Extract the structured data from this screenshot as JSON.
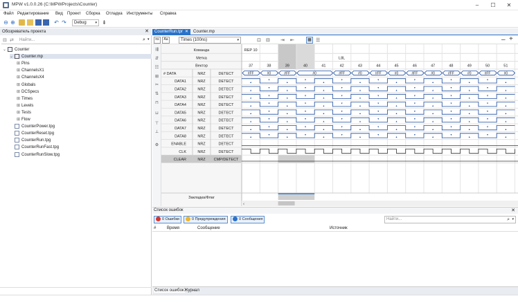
{
  "window": {
    "title": "MPW v1.0.0.26 (C:\\MPWProjects\\Counter)"
  },
  "menu": [
    "Файл",
    "Редактирование",
    "Вид",
    "Проект",
    "Сборка",
    "Отладка",
    "Инструменты",
    "Справка"
  ],
  "toolbar": {
    "config": "Debug"
  },
  "explorer": {
    "title": "Обозреватель проекта",
    "search_placeholder": "Найти...",
    "tree": [
      {
        "label": "Counter",
        "depth": 0,
        "kind": "solution",
        "expand": "v"
      },
      {
        "label": "Counter.mp",
        "depth": 1,
        "kind": "project",
        "expand": "v",
        "selected": true
      },
      {
        "label": "Pins",
        "depth": 2,
        "kind": "group",
        "expand": "+"
      },
      {
        "label": "ChannelsX1",
        "depth": 2,
        "kind": "group",
        "expand": "+"
      },
      {
        "label": "ChannelsX4",
        "depth": 2,
        "kind": "group",
        "expand": "+"
      },
      {
        "label": "Globals",
        "depth": 2,
        "kind": "group",
        "expand": "+"
      },
      {
        "label": "DCSpecs",
        "depth": 2,
        "kind": "group",
        "expand": "+"
      },
      {
        "label": "Times",
        "depth": 2,
        "kind": "group",
        "expand": "+"
      },
      {
        "label": "Levels",
        "depth": 2,
        "kind": "group",
        "expand": "+"
      },
      {
        "label": "Tests",
        "depth": 2,
        "kind": "group",
        "expand": "+"
      },
      {
        "label": "Flow",
        "depth": 2,
        "kind": "group",
        "expand": "+"
      },
      {
        "label": "CounterPower.tpg",
        "depth": 1,
        "kind": "file"
      },
      {
        "label": "CounterReset.tpg",
        "depth": 1,
        "kind": "file"
      },
      {
        "label": "CounterRun.tpg",
        "depth": 1,
        "kind": "file"
      },
      {
        "label": "CounterRunFast.tpg",
        "depth": 1,
        "kind": "file"
      },
      {
        "label": "CounterRunSlow.tpg",
        "depth": 1,
        "kind": "file"
      }
    ]
  },
  "tabs": [
    {
      "label": "CounterRun.tpr",
      "active": true,
      "close": "✕"
    },
    {
      "label": "Counter.mp",
      "active": false
    }
  ],
  "wf_toolbar": {
    "times": "Times (100ns)"
  },
  "grid": {
    "header_rows": [
      {
        "label": "Команда",
        "values": {
          "0": "REP 10"
        }
      },
      {
        "label": "Метка",
        "values": {
          "5": "L8L"
        }
      },
      {
        "label": "Вектор",
        "values": {}
      }
    ],
    "vectors": [
      "37",
      "38",
      "39",
      "40",
      "41",
      "42",
      "43",
      "44",
      "45",
      "46",
      "47",
      "48",
      "49",
      "50",
      "51"
    ],
    "signals": [
      {
        "name": "# DATA",
        "fmt": "NRZ",
        "mode": "DETECT",
        "bus": true
      },
      {
        "name": "DATA1",
        "fmt": "NRZ",
        "mode": "DETECT"
      },
      {
        "name": "DATA2",
        "fmt": "NRZ",
        "mode": "DETECT"
      },
      {
        "name": "DATA3",
        "fmt": "NRZ",
        "mode": "DETECT"
      },
      {
        "name": "DATA4",
        "fmt": "NRZ",
        "mode": "DETECT"
      },
      {
        "name": "DATA5",
        "fmt": "NRZ",
        "mode": "DETECT"
      },
      {
        "name": "DATA6",
        "fmt": "NRZ",
        "mode": "DETECT"
      },
      {
        "name": "DATA7",
        "fmt": "NRZ",
        "mode": "DETECT"
      },
      {
        "name": "DATA8",
        "fmt": "NRZ",
        "mode": "DETECT"
      },
      {
        "name": "ENABLE",
        "fmt": "NRZ",
        "mode": "DETECT"
      },
      {
        "name": "CLK",
        "fmt": "NRZ",
        "mode": "DETECT"
      },
      {
        "name": "CLEAR",
        "fmt": "NRZ",
        "mode": "CMP/DETECT",
        "selected": true
      }
    ],
    "bus_values": [
      "#FF",
      "#0",
      "#FF",
      "#0",
      "",
      "#FF",
      "#0",
      "#FF",
      "#0",
      "#FF",
      "#0",
      "#FF",
      "#0",
      "#FF",
      "#0"
    ],
    "bookmark_label": "Закладка/Флаг"
  },
  "errors": {
    "title": "Список ошибок",
    "errors_btn": "0 Ошибки",
    "warnings_btn": "0 Предупреждения",
    "messages_btn": "0 Сообщения",
    "search_placeholder": "Найти...",
    "columns": [
      "#",
      "Время",
      "Сообщение",
      "Источник"
    ]
  },
  "bottom_tabs": [
    "Список ошибок",
    "Журнал"
  ],
  "colors": {
    "accent": "#2a72c8",
    "wave": "#1f4fa0"
  }
}
